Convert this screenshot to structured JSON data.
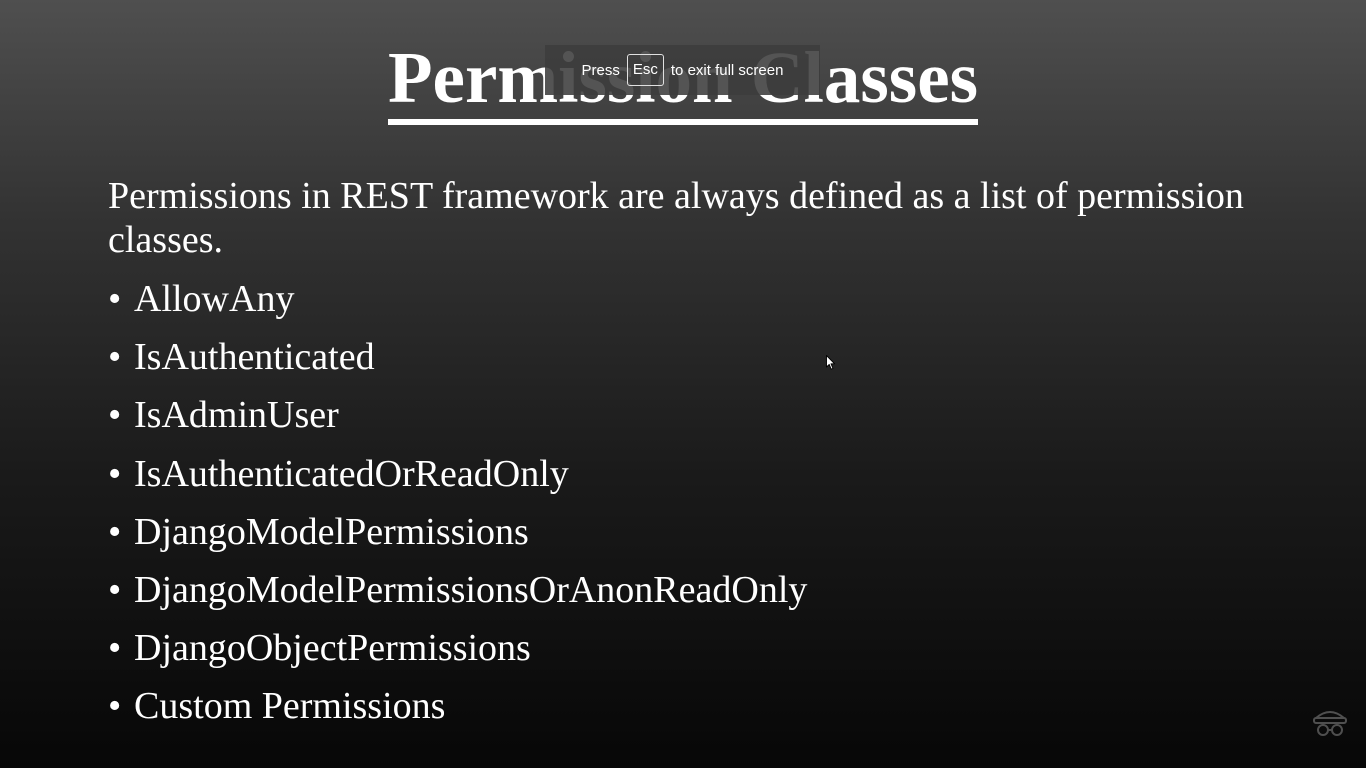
{
  "slide": {
    "title": "Permission Classes",
    "intro": "Permissions in REST framework are always defined as a list of permission classes.",
    "bullet_symbol": "•",
    "items": [
      "AllowAny",
      "IsAuthenticated",
      "IsAdminUser",
      "IsAuthenticatedOrReadOnly",
      "DjangoModelPermissions",
      "DjangoModelPermissionsOrAnonReadOnly",
      "DjangoObjectPermissions",
      "Custom Permissions"
    ]
  },
  "fullscreen_notice": {
    "press": "Press",
    "key": "Esc",
    "suffix": "to exit full screen"
  },
  "icons": {
    "cursor": "mouse-pointer-icon",
    "watermark": "watermark-logo-icon"
  },
  "colors": {
    "text": "#ffffff",
    "background_top": "#4f4f4f",
    "background_bottom": "#070707"
  }
}
